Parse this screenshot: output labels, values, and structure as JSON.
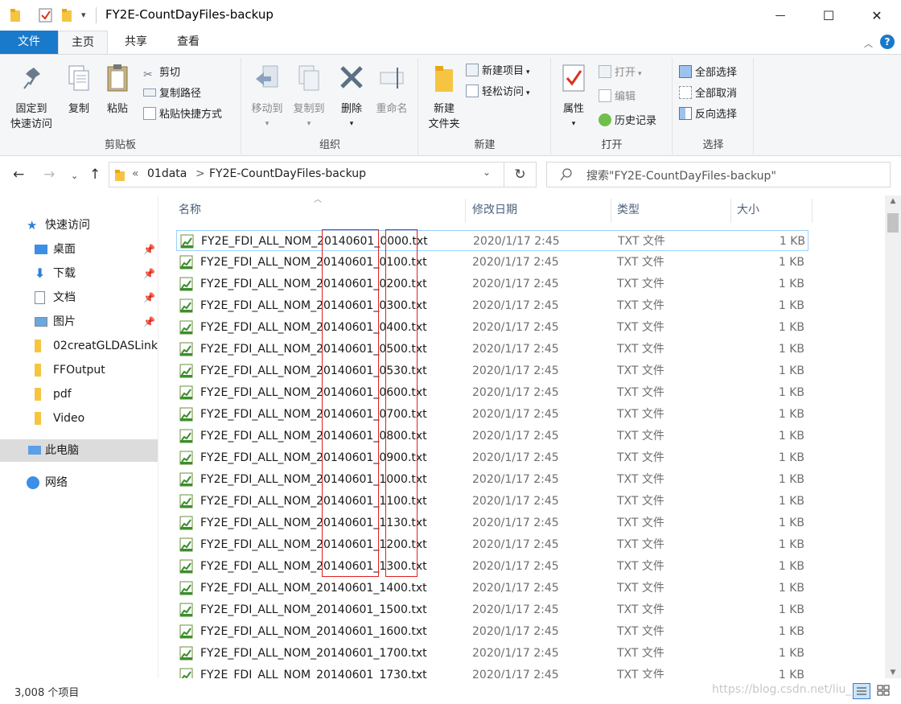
{
  "window": {
    "title": "FY2E-CountDayFiles-backup",
    "qat_dropdown": "▾",
    "minimize_glyph": "—",
    "maximize_glyph": "☐",
    "close_glyph": "✕"
  },
  "tabs": [
    {
      "label": "文件"
    },
    {
      "label": "主页"
    },
    {
      "label": "共享"
    },
    {
      "label": "查看"
    }
  ],
  "ribbon": {
    "clipboard": {
      "group_label": "剪贴板",
      "pin_label_1": "固定到",
      "pin_label_2": "快速访问",
      "copy_label": "复制",
      "paste_label": "粘贴",
      "cut_label": "剪切",
      "copy_path_label": "复制路径",
      "paste_shortcut_label": "粘贴快捷方式"
    },
    "organize": {
      "group_label": "组织",
      "move_to_label": "移动到",
      "copy_to_label": "复制到",
      "delete_label": "删除",
      "rename_label": "重命名"
    },
    "new": {
      "group_label": "新建",
      "new_folder_label_1": "新建",
      "new_folder_label_2": "文件夹",
      "new_item_label": "新建项目",
      "easy_access_label": "轻松访问"
    },
    "open": {
      "group_label": "打开",
      "properties_label": "属性",
      "open_label": "打开",
      "edit_label": "编辑",
      "history_label": "历史记录"
    },
    "select": {
      "group_label": "选择",
      "select_all_label": "全部选择",
      "select_none_label": "全部取消",
      "invert_label": "反向选择"
    }
  },
  "address": {
    "chevron": "«",
    "crumb_1": "01data",
    "sep": ">",
    "crumb_2": "FY2E-CountDayFiles-backup",
    "search_placeholder": "搜索\"FY2E-CountDayFiles-backup\""
  },
  "sidebar": {
    "items": [
      {
        "label": "快速访问"
      },
      {
        "label": "桌面"
      },
      {
        "label": "下载"
      },
      {
        "label": "文档"
      },
      {
        "label": "图片"
      },
      {
        "label": "02creatGLDASLink"
      },
      {
        "label": "FFOutput"
      },
      {
        "label": "pdf"
      },
      {
        "label": "Video"
      },
      {
        "label": "此电脑"
      },
      {
        "label": "网络"
      }
    ]
  },
  "columns": {
    "name": "名称",
    "date": "修改日期",
    "type": "类型",
    "size": "大小"
  },
  "files": [
    {
      "name": "FY2E_FDI_ALL_NOM_20140601_0000.txt",
      "date": "2020/1/17 2:45",
      "type": "TXT 文件",
      "size": "1 KB"
    },
    {
      "name": "FY2E_FDI_ALL_NOM_20140601_0100.txt",
      "date": "2020/1/17 2:45",
      "type": "TXT 文件",
      "size": "1 KB"
    },
    {
      "name": "FY2E_FDI_ALL_NOM_20140601_0200.txt",
      "date": "2020/1/17 2:45",
      "type": "TXT 文件",
      "size": "1 KB"
    },
    {
      "name": "FY2E_FDI_ALL_NOM_20140601_0300.txt",
      "date": "2020/1/17 2:45",
      "type": "TXT 文件",
      "size": "1 KB"
    },
    {
      "name": "FY2E_FDI_ALL_NOM_20140601_0400.txt",
      "date": "2020/1/17 2:45",
      "type": "TXT 文件",
      "size": "1 KB"
    },
    {
      "name": "FY2E_FDI_ALL_NOM_20140601_0500.txt",
      "date": "2020/1/17 2:45",
      "type": "TXT 文件",
      "size": "1 KB"
    },
    {
      "name": "FY2E_FDI_ALL_NOM_20140601_0530.txt",
      "date": "2020/1/17 2:45",
      "type": "TXT 文件",
      "size": "1 KB"
    },
    {
      "name": "FY2E_FDI_ALL_NOM_20140601_0600.txt",
      "date": "2020/1/17 2:45",
      "type": "TXT 文件",
      "size": "1 KB"
    },
    {
      "name": "FY2E_FDI_ALL_NOM_20140601_0700.txt",
      "date": "2020/1/17 2:45",
      "type": "TXT 文件",
      "size": "1 KB"
    },
    {
      "name": "FY2E_FDI_ALL_NOM_20140601_0800.txt",
      "date": "2020/1/17 2:45",
      "type": "TXT 文件",
      "size": "1 KB"
    },
    {
      "name": "FY2E_FDI_ALL_NOM_20140601_0900.txt",
      "date": "2020/1/17 2:45",
      "type": "TXT 文件",
      "size": "1 KB"
    },
    {
      "name": "FY2E_FDI_ALL_NOM_20140601_1000.txt",
      "date": "2020/1/17 2:45",
      "type": "TXT 文件",
      "size": "1 KB"
    },
    {
      "name": "FY2E_FDI_ALL_NOM_20140601_1100.txt",
      "date": "2020/1/17 2:45",
      "type": "TXT 文件",
      "size": "1 KB"
    },
    {
      "name": "FY2E_FDI_ALL_NOM_20140601_1130.txt",
      "date": "2020/1/17 2:45",
      "type": "TXT 文件",
      "size": "1 KB"
    },
    {
      "name": "FY2E_FDI_ALL_NOM_20140601_1200.txt",
      "date": "2020/1/17 2:45",
      "type": "TXT 文件",
      "size": "1 KB"
    },
    {
      "name": "FY2E_FDI_ALL_NOM_20140601_1300.txt",
      "date": "2020/1/17 2:45",
      "type": "TXT 文件",
      "size": "1 KB"
    },
    {
      "name": "FY2E_FDI_ALL_NOM_20140601_1400.txt",
      "date": "2020/1/17 2:45",
      "type": "TXT 文件",
      "size": "1 KB"
    },
    {
      "name": "FY2E_FDI_ALL_NOM_20140601_1500.txt",
      "date": "2020/1/17 2:45",
      "type": "TXT 文件",
      "size": "1 KB"
    },
    {
      "name": "FY2E_FDI_ALL_NOM_20140601_1600.txt",
      "date": "2020/1/17 2:45",
      "type": "TXT 文件",
      "size": "1 KB"
    },
    {
      "name": "FY2E_FDI_ALL_NOM_20140601_1700.txt",
      "date": "2020/1/17 2:45",
      "type": "TXT 文件",
      "size": "1 KB"
    },
    {
      "name": "FY2E_FDI_ALL_NOM_20140601_1730.txt",
      "date": "2020/1/17 2:45",
      "type": "TXT 文件",
      "size": "1 KB"
    }
  ],
  "status": {
    "item_count": "3,008 个项目",
    "watermark": "https://blog.csdn.net/liu_"
  },
  "colors": {
    "accent": "#1979ca",
    "highlight_box": "#e02020",
    "selected_nav": "#dcdcdc",
    "focus_border": "#99d1ff"
  }
}
